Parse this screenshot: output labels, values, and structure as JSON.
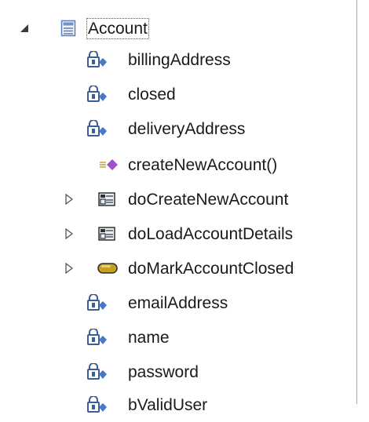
{
  "tree": {
    "root": {
      "label": "Account",
      "icon": "class-icon",
      "expanded": true
    },
    "children": [
      {
        "label": "billingAddress",
        "icon": "private-field-icon",
        "kind": "field"
      },
      {
        "label": "closed",
        "icon": "private-field-icon",
        "kind": "field"
      },
      {
        "label": "deliveryAddress",
        "icon": "private-field-icon",
        "kind": "field"
      },
      {
        "label": "createNewAccount()",
        "icon": "method-icon",
        "kind": "method"
      },
      {
        "label": "doCreateNewAccount",
        "icon": "structure-icon",
        "kind": "expandable"
      },
      {
        "label": "doLoadAccountDetails",
        "icon": "structure-icon",
        "kind": "expandable"
      },
      {
        "label": "doMarkAccountClosed",
        "icon": "capsule-icon",
        "kind": "expandable"
      },
      {
        "label": "emailAddress",
        "icon": "private-field-icon",
        "kind": "field"
      },
      {
        "label": "name",
        "icon": "private-field-icon",
        "kind": "field"
      },
      {
        "label": "password",
        "icon": "private-field-icon",
        "kind": "field"
      },
      {
        "label": "bValidUser",
        "icon": "private-field-icon",
        "kind": "field"
      }
    ]
  },
  "colors": {
    "field_diamond": "#4a78c8",
    "method_diamond": "#a050c8",
    "capsule_fill": "#c8a020",
    "twisty_expanded": "#404040",
    "twisty_collapsed": "#808080"
  }
}
